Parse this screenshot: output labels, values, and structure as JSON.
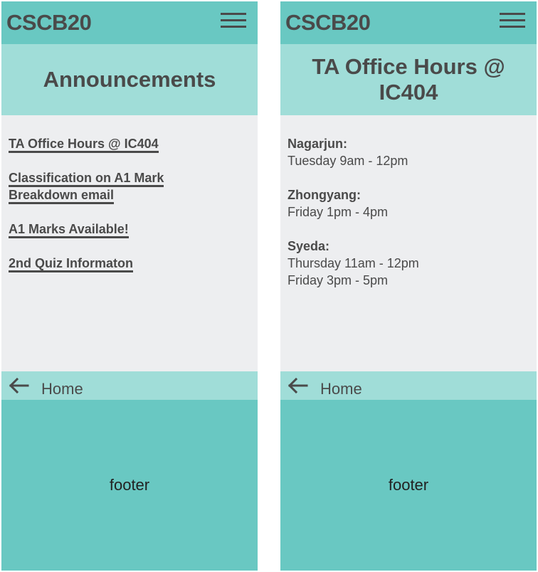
{
  "screens": [
    {
      "brand": "CSCB20",
      "title": "Announcements",
      "announcements": [
        "TA Office Hours @ IC404",
        "Classification on A1 Mark Breakdown email",
        "A1 Marks Available!",
        "2nd Quiz Informaton"
      ],
      "home_label": "Home",
      "footer": "footer"
    },
    {
      "brand": "CSCB20",
      "title": "TA Office Hours @ IC404",
      "tas": [
        {
          "name": "Nagarjun:",
          "hours": [
            "Tuesday 9am - 12pm"
          ]
        },
        {
          "name": "Zhongyang:",
          "hours": [
            "Friday 1pm - 4pm"
          ]
        },
        {
          "name": "Syeda:",
          "hours": [
            "Thursday 11am - 12pm",
            "Friday 3pm - 5pm"
          ]
        }
      ],
      "home_label": "Home",
      "footer": "footer"
    }
  ],
  "colors": {
    "header": "#69c8c2",
    "title_band": "#a0ddd8",
    "content_bg": "#edeef0",
    "text": "#4a4a4a"
  },
  "icons": {
    "menu": "hamburger-menu-icon",
    "back": "arrow-left-icon"
  }
}
